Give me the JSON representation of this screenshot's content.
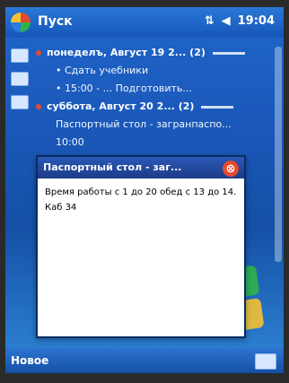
{
  "titlebar": {
    "title": "Пуск",
    "clock": "19:04"
  },
  "list": {
    "rows": [
      {
        "type": "header",
        "text": "понеделъ, Август 19 2... (2)"
      },
      {
        "type": "sub",
        "text": "• Сдать учебники"
      },
      {
        "type": "sub",
        "text": "• 15:00 - ... Подготовить..."
      },
      {
        "type": "header",
        "text": "суббота, Август 20 2... (2)"
      },
      {
        "type": "sub",
        "text": "Паспортный стол - загранпаспо..."
      },
      {
        "type": "sub",
        "text": "10:00"
      }
    ]
  },
  "popup": {
    "title": "Паспортный стол - заг...",
    "close_label": "⊗",
    "line1": "Время работы с 1 до 20 обед с 13 до 14.",
    "line2": "Каб 34"
  },
  "bottombar": {
    "left": "Новое"
  }
}
